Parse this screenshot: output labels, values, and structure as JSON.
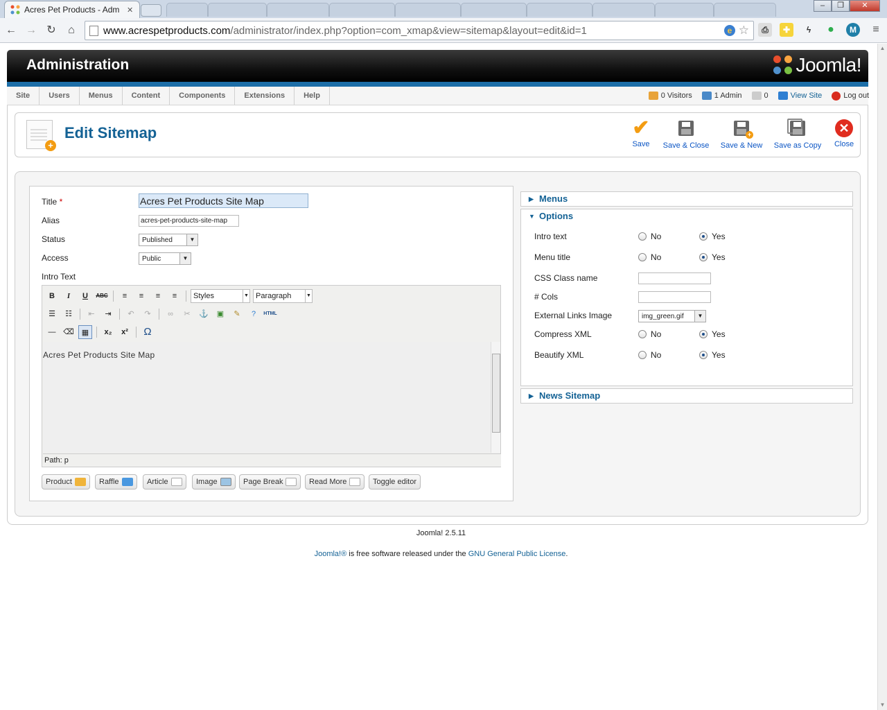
{
  "browser": {
    "active_tab_title": "Acres Pet Products - Adm",
    "url_host": "www.acrespetproducts.com",
    "url_path": "/administrator/index.php?option=com_xmap&view=sitemap&layout=edit&id=1"
  },
  "header": {
    "title": "Administration",
    "logo_text": "Joomla!"
  },
  "menu": {
    "items": [
      "Site",
      "Users",
      "Menus",
      "Content",
      "Components",
      "Extensions",
      "Help"
    ]
  },
  "status": {
    "visitors": "0 Visitors",
    "admins": "1 Admin",
    "messages": "0",
    "view_site": "View Site",
    "logout": "Log out"
  },
  "toolbar": {
    "page_title": "Edit Sitemap",
    "save": "Save",
    "save_close": "Save & Close",
    "save_new": "Save & New",
    "save_copy": "Save as Copy",
    "close": "Close"
  },
  "form": {
    "title_label": "Title",
    "required_mark": "*",
    "title_value": "Acres Pet Products Site Map",
    "alias_label": "Alias",
    "alias_value": "acres-pet-products-site-map",
    "status_label": "Status",
    "status_value": "Published",
    "access_label": "Access",
    "access_value": "Public",
    "intro_label": "Intro Text"
  },
  "editor": {
    "styles_label": "Styles",
    "format_label": "Paragraph",
    "content": "Acres Pet Products Site Map",
    "path": "Path: p",
    "html_button": "HTML"
  },
  "editor_buttons": [
    "Product",
    "Raffle",
    "Article",
    "Image",
    "Page Break",
    "Read More",
    "Toggle editor"
  ],
  "panels": {
    "menus": "Menus",
    "options": "Options",
    "news": "News Sitemap"
  },
  "options": {
    "intro_text": "Intro text",
    "menu_title": "Menu title",
    "css_class": "CSS Class name",
    "cols": "# Cols",
    "ext_links_image": "External Links Image",
    "ext_links_value": "img_green.gif",
    "compress_xml": "Compress XML",
    "beautify_xml": "Beautify XML",
    "no": "No",
    "yes": "Yes"
  },
  "footer": {
    "version": "Joomla! 2.5.11",
    "license_link1": "Joomla!®",
    "license_text": " is free software released under the ",
    "license_link2": "GNU General Public License",
    "license_end": "."
  }
}
